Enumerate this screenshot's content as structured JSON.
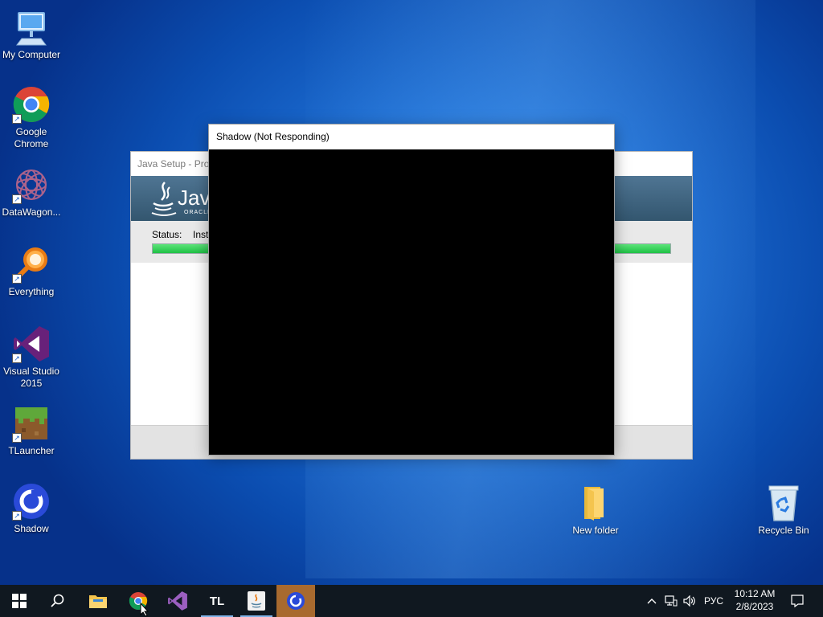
{
  "desktop": {
    "icons": [
      {
        "label": "My Computer"
      },
      {
        "label": "Google Chrome"
      },
      {
        "label": "DataWagon..."
      },
      {
        "label": "Everything"
      },
      {
        "label": "Visual Studio 2015"
      },
      {
        "label": "TLauncher"
      },
      {
        "label": "Shadow"
      },
      {
        "label": "New folder"
      },
      {
        "label": "Recycle Bin"
      }
    ]
  },
  "java_window": {
    "title": "Java Setup - Prog",
    "banner_text": "Java",
    "banner_sub": "ORACLE",
    "status_label": "Status:",
    "status_value": "Inst",
    "progress_fraction": 1.0,
    "progress_color": "#1fc145"
  },
  "shadow_window": {
    "title": "Shadow (Not Responding)"
  },
  "taskbar": {
    "tl_label": "TL",
    "language": "РУС",
    "time": "10:12 AM",
    "date": "2/8/2023"
  },
  "colors": {
    "desktop_blue": "#1e6fd4",
    "taskbar_bg": "#101820",
    "shadow_taskbar_highlight": "#a86a2f"
  }
}
